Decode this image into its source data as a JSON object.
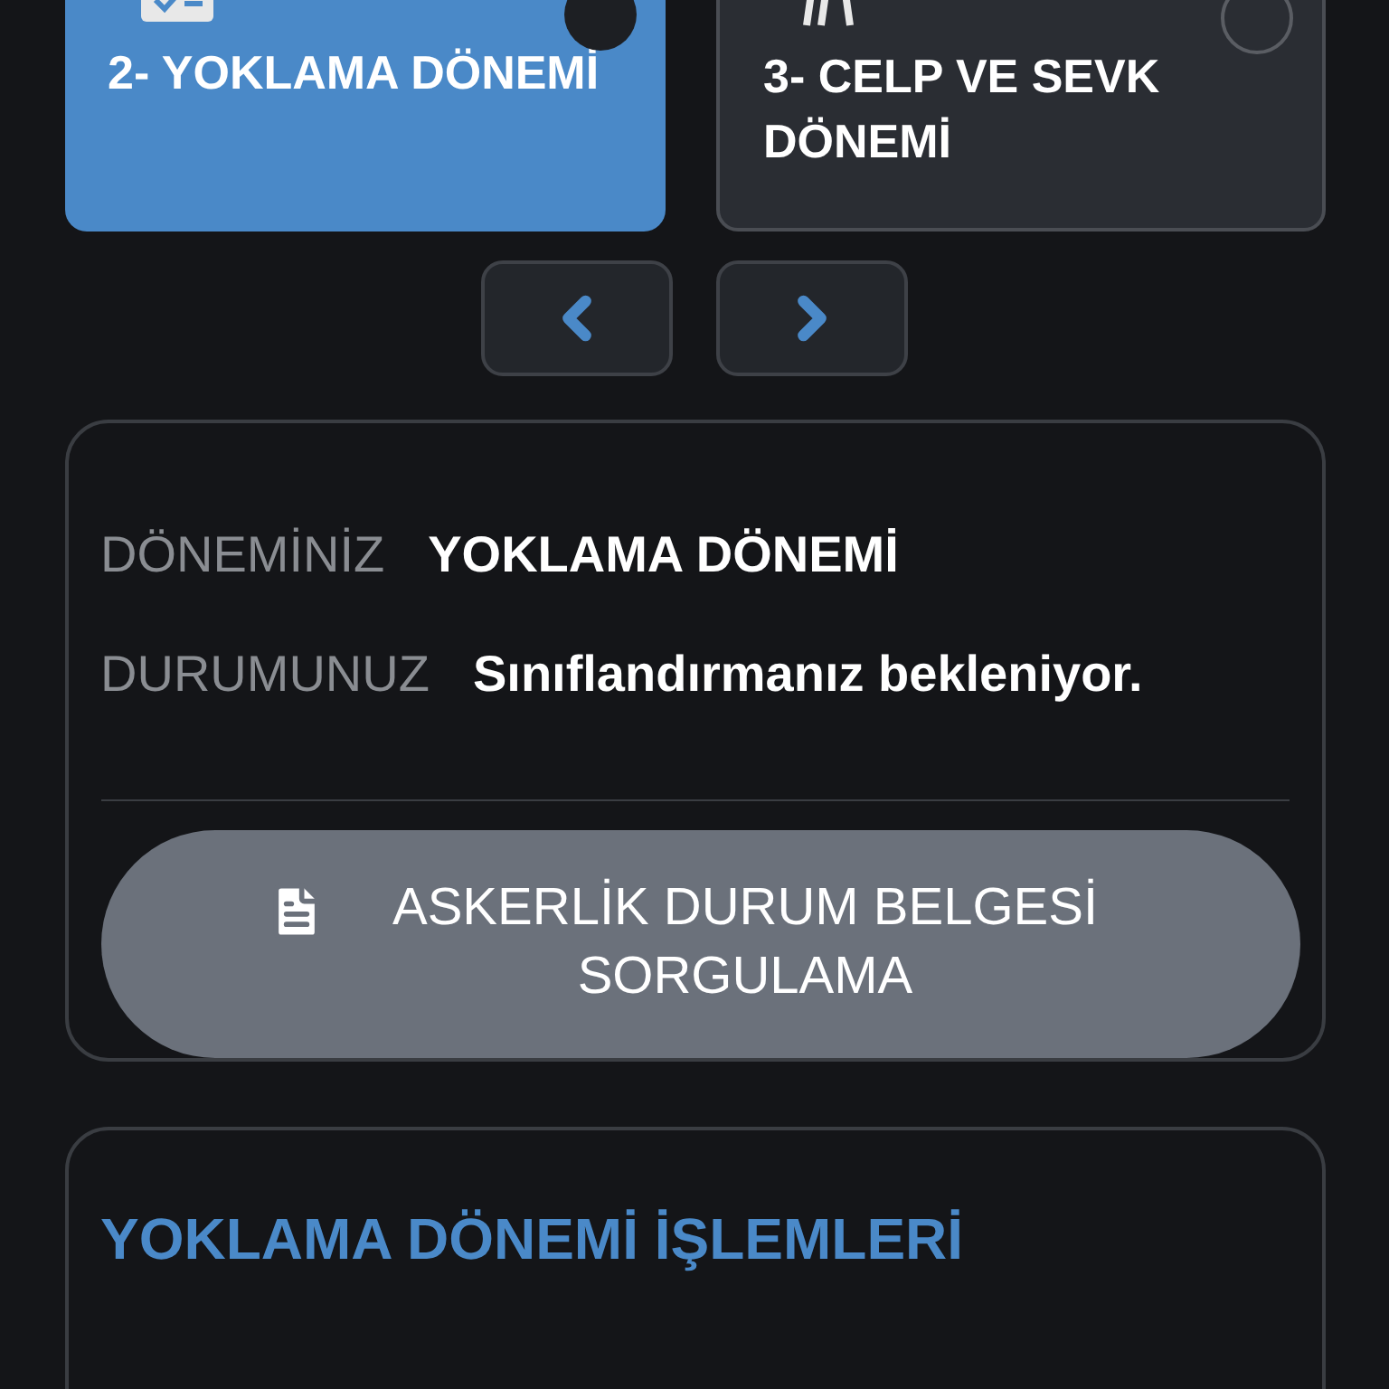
{
  "periods": [
    {
      "label": "2- YOKLAMA DÖNEMİ",
      "selected": true
    },
    {
      "label": "3- CELP VE SEVK DÖNEMİ",
      "selected": false
    }
  ],
  "status": {
    "rows": [
      {
        "label": "DÖNEMİNİZ",
        "value": "YOKLAMA DÖNEMİ"
      },
      {
        "label": "DURUMUNUZ",
        "value": "Sınıflandırmanız bekleniyor."
      }
    ],
    "button": "ASKERLİK DURUM BELGESİ SORGULAMA"
  },
  "operations": {
    "title": "YOKLAMA DÖNEMİ İŞLEMLERİ"
  }
}
